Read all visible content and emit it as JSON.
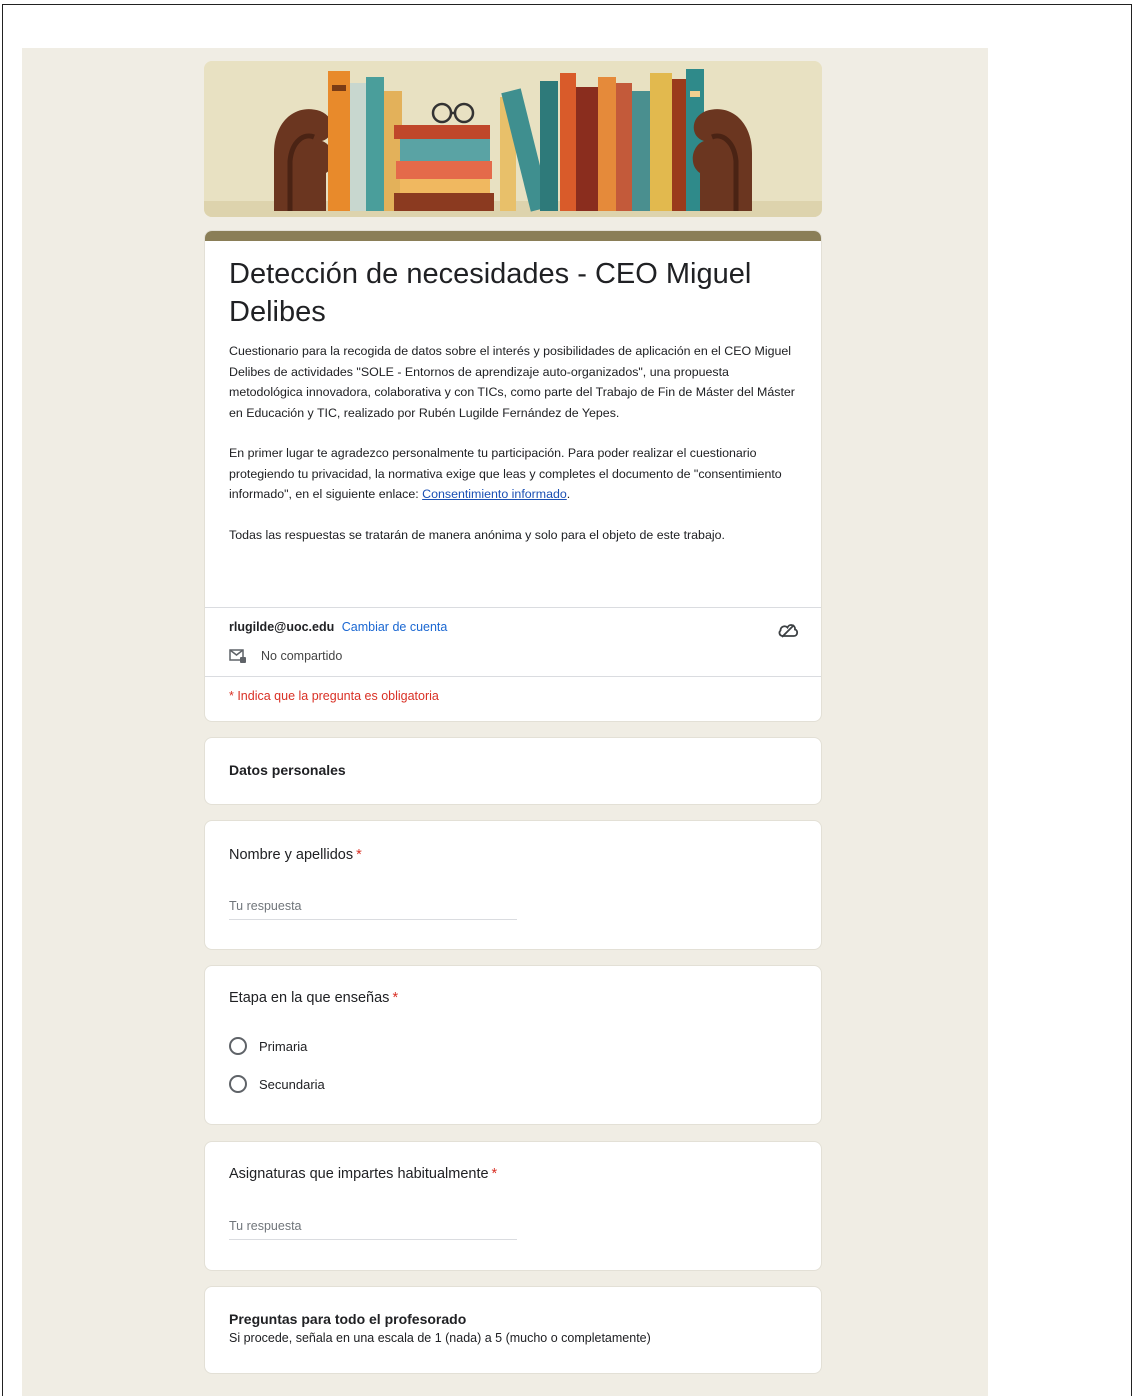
{
  "form": {
    "title": "Detección de necesidades - CEO Miguel Delibes",
    "description_1": "Cuestionario para la recogida de datos sobre el interés y posibilidades de aplicación en el CEO Miguel Delibes de actividades \"SOLE - Entornos de aprendizaje auto-organizados\", una propuesta metodológica innovadora, colaborativa y con TICs, como parte del Trabajo de Fin de Máster del Máster en Educación y TIC,  realizado por Rubén Lugilde Fernández de Yepes.",
    "description_2_before_link": "En primer lugar te agradezco personalmente tu participación. Para poder realizar el cuestionario protegiendo tu privacidad, la normativa exige que leas y completes el documento de \"consentimiento informado\", en el siguiente enlace: ",
    "consent_link": "Consentimiento informado",
    "description_2_after_link": ".",
    "description_3": "Todas las respuestas se tratarán de manera anónima y solo para el objeto de este trabajo."
  },
  "account": {
    "email": "rlugilde@uoc.edu",
    "switch_label": "Cambiar de cuenta",
    "shared_label": "No compartido",
    "cloud_icon": "cloud-icon",
    "shared_icon": "mail-lock-icon"
  },
  "required_note": "* Indica que la pregunta es obligatoria",
  "sections": {
    "personal": {
      "title": "Datos personales"
    },
    "all_teachers": {
      "title": "Preguntas para todo el profesorado",
      "subtitle": "Si procede, señala en una escala de 1 (nada) a 5 (mucho o completamente)"
    }
  },
  "questions": {
    "name": {
      "title": "Nombre y apellidos",
      "star": "*",
      "placeholder": "Tu respuesta"
    },
    "stage": {
      "title": "Etapa en la que enseñas",
      "star": "*",
      "options": [
        "Primaria",
        "Secundaria"
      ]
    },
    "subjects": {
      "title": "Asignaturas que impartes habitualmente",
      "star": "*",
      "placeholder": "Tu respuesta"
    }
  },
  "colors": {
    "canvas": "#f0ede4",
    "theme_bar": "#8a7e57",
    "required": "#d93025",
    "link": "#1a67d2"
  }
}
